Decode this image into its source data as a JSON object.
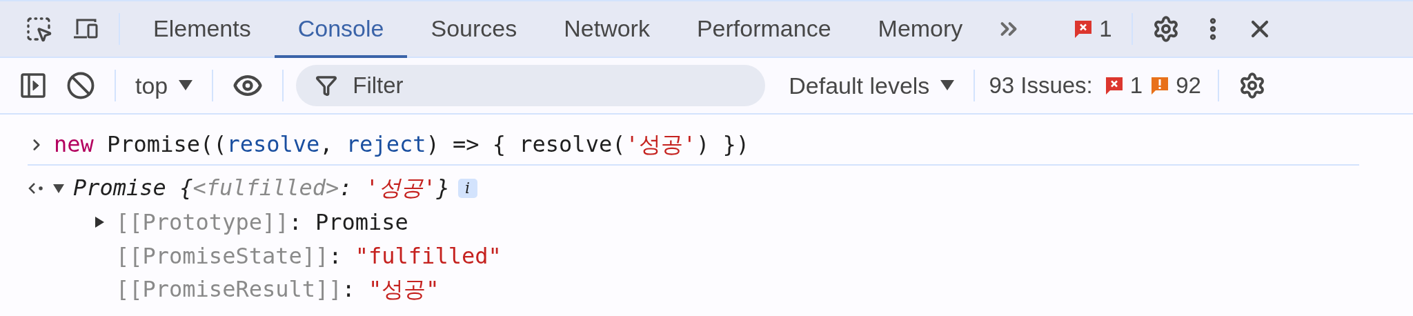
{
  "tabs": [
    {
      "label": "Elements",
      "selected": false
    },
    {
      "label": "Console",
      "selected": true
    },
    {
      "label": "Sources",
      "selected": false
    },
    {
      "label": "Network",
      "selected": false
    },
    {
      "label": "Performance",
      "selected": false
    },
    {
      "label": "Memory",
      "selected": false
    }
  ],
  "error_count": "1",
  "toolbar": {
    "context": "top",
    "filter": {
      "placeholder": "Filter"
    },
    "levels": "Default levels",
    "issues": {
      "label": "93 Issues:",
      "counts": [
        {
          "kind": "error",
          "count": "1"
        },
        {
          "kind": "warning",
          "count": "92"
        }
      ]
    }
  },
  "console": {
    "input": [
      {
        "text": "new",
        "kind": "keyword"
      },
      {
        "text": " Promise((",
        "kind": "plain"
      },
      {
        "text": "resolve",
        "kind": "variable"
      },
      {
        "text": ", ",
        "kind": "plain"
      },
      {
        "text": "reject",
        "kind": "variable"
      },
      {
        "text": ") => { resolve(",
        "kind": "plain"
      },
      {
        "text": "'성공'",
        "kind": "string"
      },
      {
        "text": ") })",
        "kind": "plain"
      }
    ],
    "output": {
      "expanded": true,
      "preview": [
        {
          "text": "Promise {",
          "kind": "plain"
        },
        {
          "text": "<fulfilled>",
          "kind": "meta"
        },
        {
          "text": ": ",
          "kind": "plain"
        },
        {
          "text": "'성공'",
          "kind": "string"
        },
        {
          "text": "}",
          "kind": "plain"
        }
      ],
      "info": "i",
      "properties": [
        {
          "kind": "object",
          "expanded": false,
          "tokens": [
            {
              "text": "[[Prototype]]",
              "kind": "meta"
            },
            {
              "text": ": ",
              "kind": "plain"
            },
            {
              "text": "Promise",
              "kind": "plain"
            }
          ]
        },
        {
          "kind": "primitive",
          "tokens": [
            {
              "text": "[[PromiseState]]",
              "kind": "meta"
            },
            {
              "text": ": ",
              "kind": "plain"
            },
            {
              "text": "\"fulfilled\"",
              "kind": "string"
            }
          ]
        },
        {
          "kind": "primitive",
          "tokens": [
            {
              "text": "[[PromiseResult]]",
              "kind": "meta"
            },
            {
              "text": ": ",
              "kind": "plain"
            },
            {
              "text": "\"성공\"",
              "kind": "string"
            }
          ]
        }
      ]
    }
  }
}
